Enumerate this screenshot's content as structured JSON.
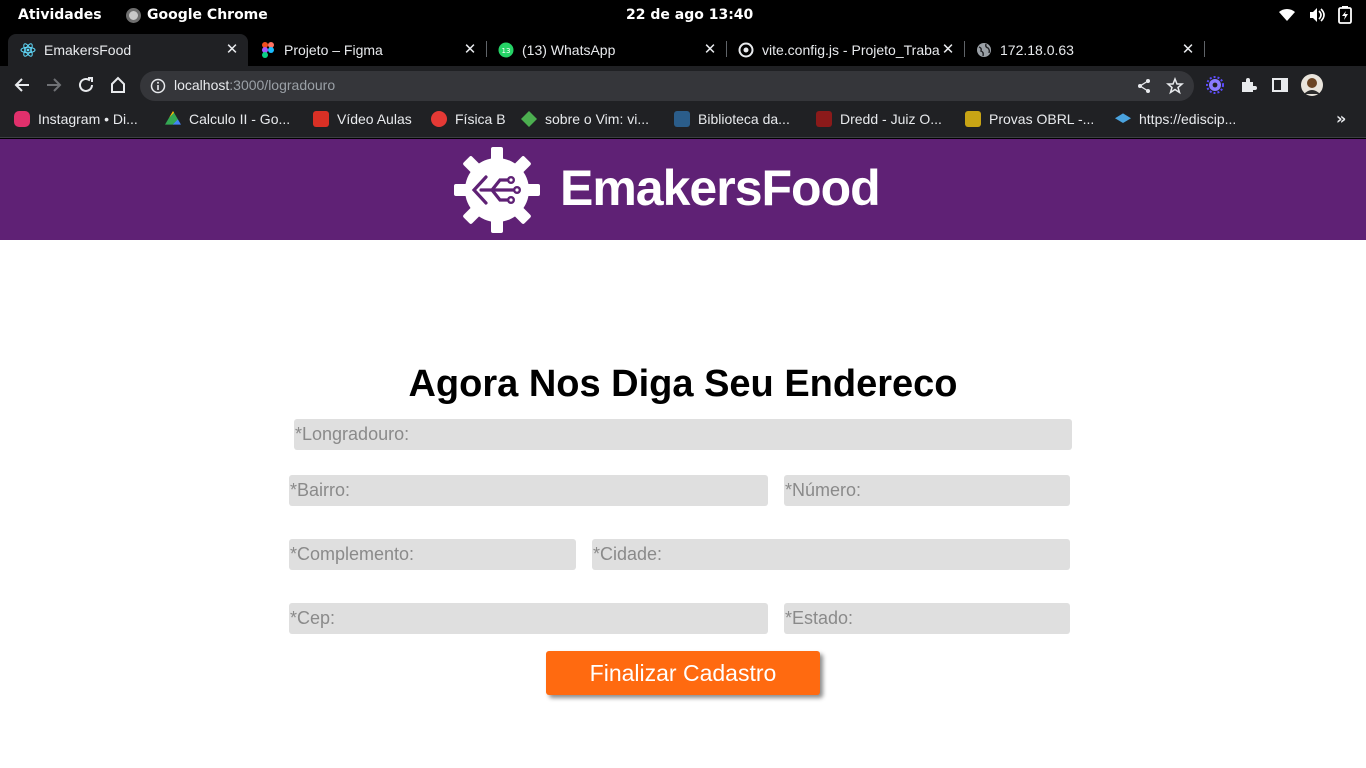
{
  "system_bar": {
    "activities": "Atividades",
    "app_name": "Google Chrome",
    "clock": "22 de ago  13:40"
  },
  "tabs": [
    {
      "title": "EmakersFood",
      "icon": "react-icon",
      "active": true
    },
    {
      "title": "Projeto – Figma",
      "icon": "figma-icon",
      "active": false
    },
    {
      "title": "(13) WhatsApp",
      "icon": "whatsapp-icon",
      "active": false
    },
    {
      "title": "vite.config.js - Projeto_Trabalho",
      "icon": "github-icon",
      "active": false
    },
    {
      "title": "172.18.0.63",
      "icon": "globe-icon",
      "active": false
    }
  ],
  "address_bar": {
    "host": "localhost",
    "path": ":3000/logradouro"
  },
  "bookmarks": [
    {
      "label": "Instagram • Di...",
      "color": "#e1306c"
    },
    {
      "label": "Calculo II - Go...",
      "color": "#34a853"
    },
    {
      "label": "Vídeo Aulas",
      "color": "#d93025"
    },
    {
      "label": "Física B",
      "color": "#e53935"
    },
    {
      "label": "sobre o Vim: vi...",
      "color": "#4caf50"
    },
    {
      "label": "Biblioteca da...",
      "color": "#2b5d8a"
    },
    {
      "label": "Dredd - Juiz O...",
      "color": "#8b1a1a"
    },
    {
      "label": "Provas OBRL -...",
      "color": "#c8a415"
    },
    {
      "label": "https://ediscip...",
      "color": "#4aa3df"
    }
  ],
  "brand": {
    "name": "EmakersFood",
    "bar_color": "#5f2175"
  },
  "form": {
    "title": "Agora Nos Diga Seu Endereco",
    "fields": {
      "logradouro": "*Longradouro:",
      "bairro": "*Bairro:",
      "numero": "*Número:",
      "complemento": "*Complemento:",
      "cidade": "*Cidade:",
      "cep": "*Cep:",
      "estado": "*Estado:"
    },
    "submit_label": "Finalizar Cadastro",
    "submit_color": "#ff6a10"
  }
}
